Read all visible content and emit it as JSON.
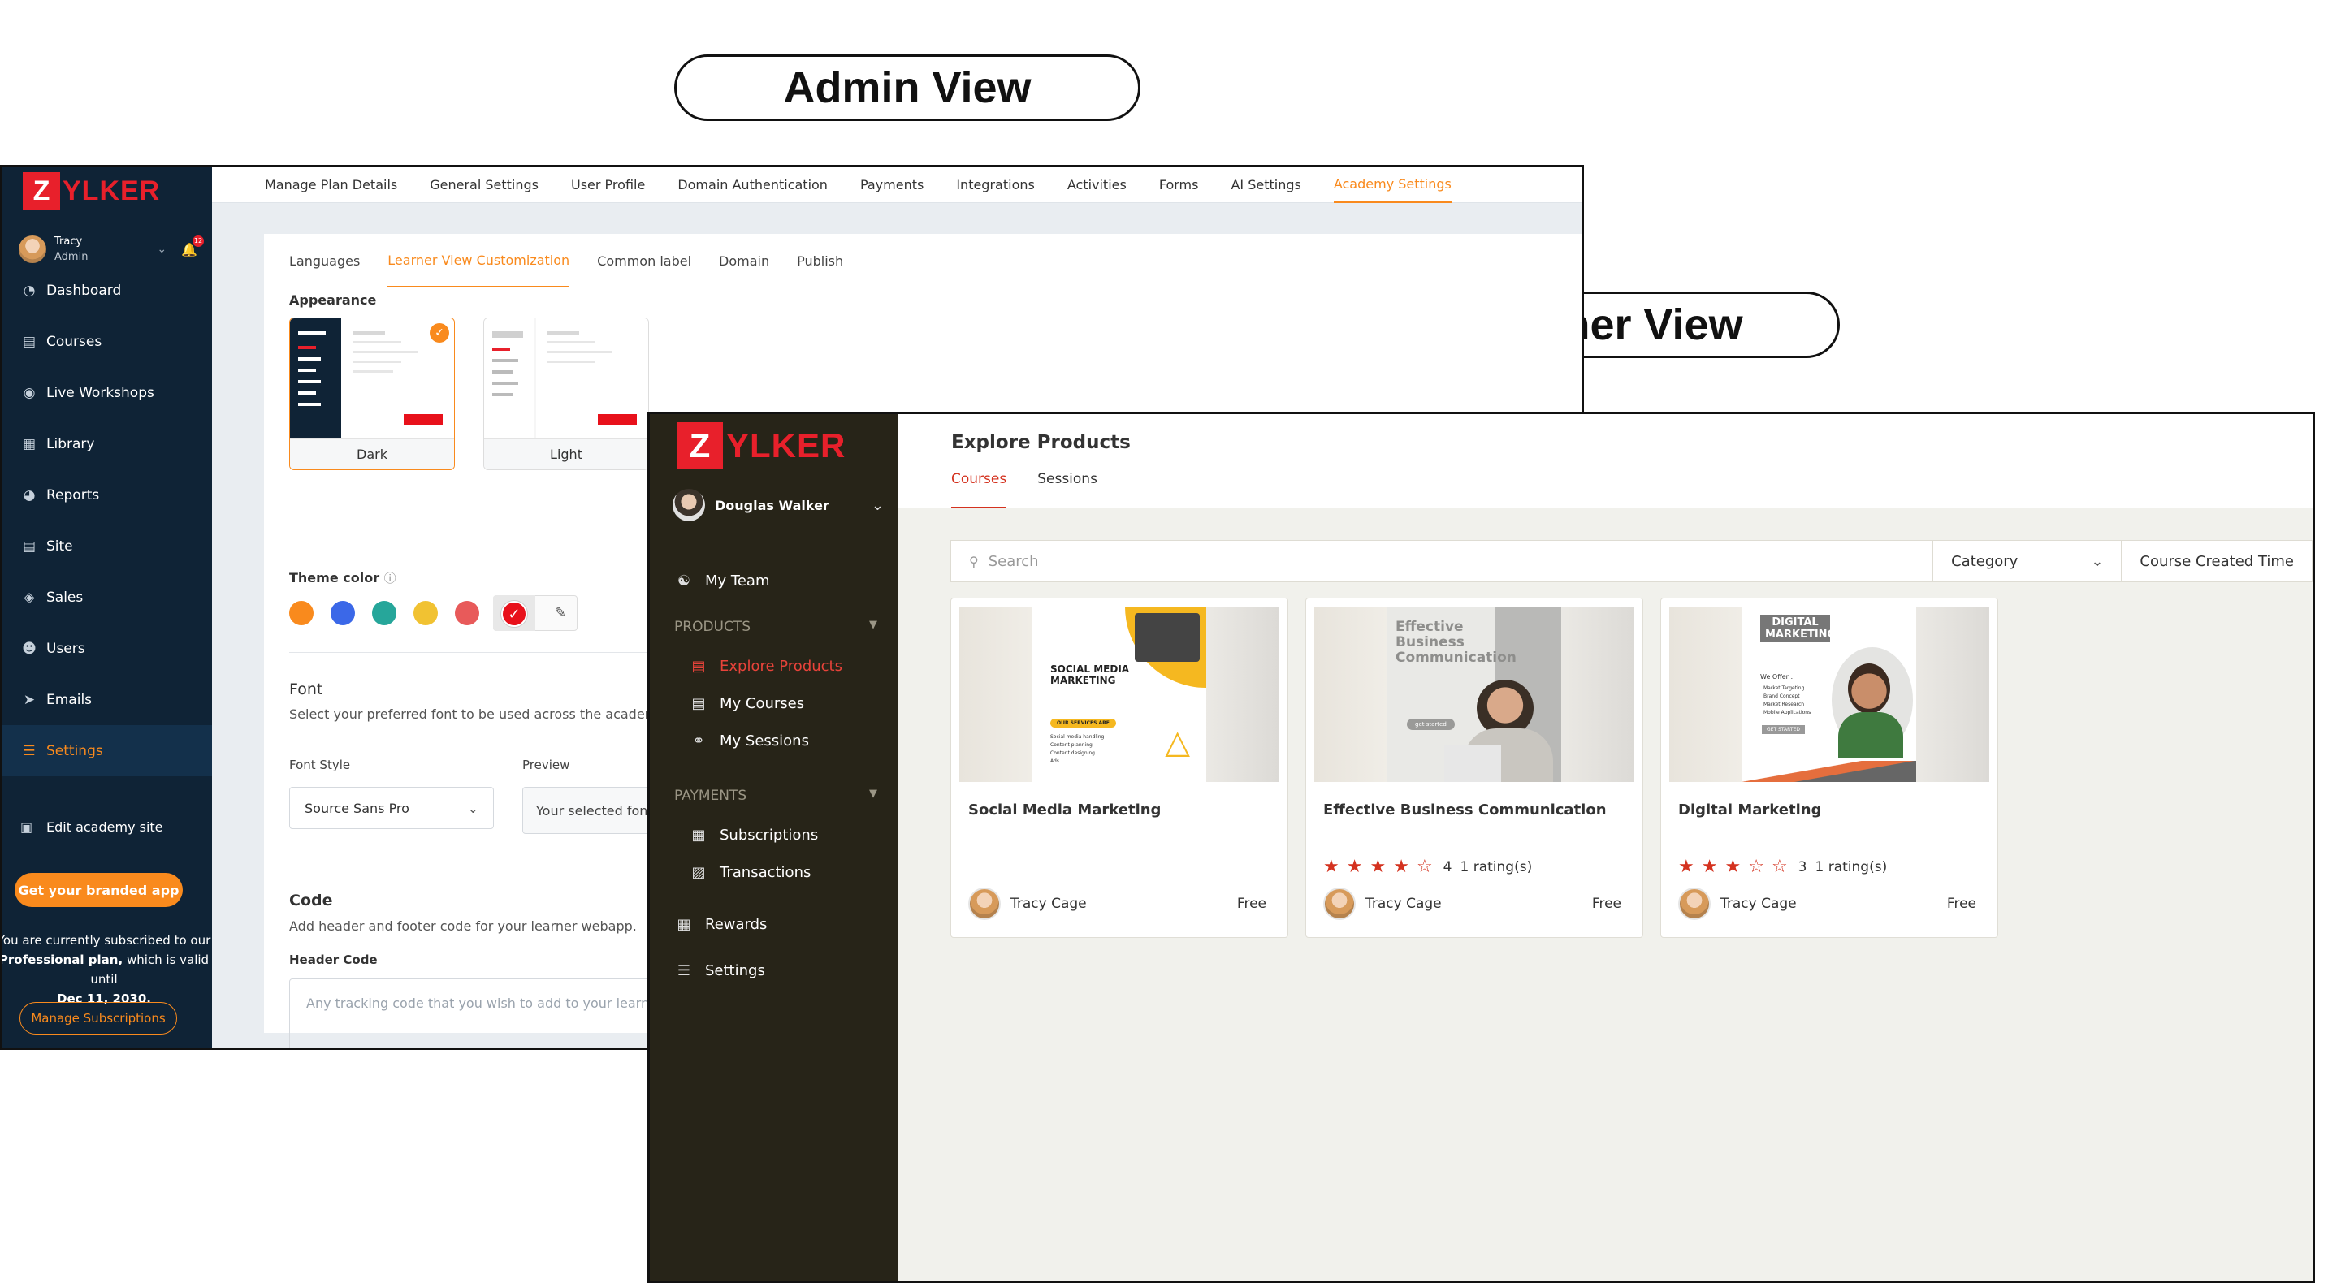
{
  "labels": {
    "admin": "Admin View",
    "learner": "Learner View"
  },
  "admin": {
    "logo": {
      "letter": "Z",
      "text": "YLKER"
    },
    "user": {
      "name": "Tracy",
      "role": "Admin",
      "notifications": "12"
    },
    "nav": [
      {
        "label": "Dashboard",
        "icon": "dashboard-icon"
      },
      {
        "label": "Courses",
        "icon": "courses-icon"
      },
      {
        "label": "Live Workshops",
        "icon": "live-workshops-icon"
      },
      {
        "label": "Library",
        "icon": "library-icon"
      },
      {
        "label": "Reports",
        "icon": "reports-icon"
      },
      {
        "label": "Site",
        "icon": "site-icon"
      },
      {
        "label": "Sales",
        "icon": "sales-tag-icon"
      },
      {
        "label": "Users",
        "icon": "users-icon"
      },
      {
        "label": "Emails",
        "icon": "emails-icon"
      },
      {
        "label": "Settings",
        "icon": "settings-sliders-icon"
      }
    ],
    "edit_site": "Edit academy site",
    "branded_app": "Get your branded app",
    "plan": {
      "line1": "You are currently subscribed to our",
      "plan_name": "Professional plan,",
      "line2": "which is valid until",
      "date": "Dec 11, 2030."
    },
    "manage_subscriptions": "Manage Subscriptions",
    "top_tabs": [
      "Manage Plan Details",
      "General Settings",
      "User Profile",
      "Domain Authentication",
      "Payments",
      "Integrations",
      "Activities",
      "Forms",
      "AI Settings",
      "Academy Settings"
    ],
    "sub_tabs": [
      "Languages",
      "Learner View Customization",
      "Common label",
      "Domain",
      "Publish"
    ],
    "appearance": {
      "heading": "Appearance",
      "options": [
        "Dark",
        "Light"
      ],
      "selected": "Dark"
    },
    "theme_color": {
      "heading": "Theme color",
      "colors": [
        "#f98a1d",
        "#3b68e8",
        "#26a69a",
        "#f1c232",
        "#e85a5a",
        "#e8111b"
      ],
      "selected": "#e8111b"
    },
    "font": {
      "heading": "Font",
      "description": "Select your preferred font to be used across the academy.",
      "style_label": "Font Style",
      "style_value": "Source Sans Pro",
      "preview_label": "Preview",
      "preview_text": "Your selected font w"
    },
    "code": {
      "heading": "Code",
      "description": "Add header and footer code for your learner webapp.",
      "header_label": "Header Code",
      "header_placeholder": "Any tracking code that you wish to add to your learner web"
    }
  },
  "learner": {
    "logo": {
      "letter": "Z",
      "text": "YLKER"
    },
    "user": {
      "name": "Douglas Walker"
    },
    "my_team": "My Team",
    "products_section": "PRODUCTS",
    "products_items": [
      "Explore Products",
      "My Courses",
      "My Sessions"
    ],
    "payments_section": "PAYMENTS",
    "payments_items": [
      "Subscriptions",
      "Transactions"
    ],
    "rewards": "Rewards",
    "settings": "Settings",
    "page_title": "Explore Products",
    "tabs": [
      "Courses",
      "Sessions"
    ],
    "search_placeholder": "Search",
    "filters": [
      "Category",
      "Course Created Time"
    ],
    "courses": [
      {
        "title": "Social Media Marketing",
        "author": "Tracy Cage",
        "price": "Free",
        "rating": null,
        "rating_count": "",
        "image_text": "SOCIAL MEDIA MARKETING",
        "image_badge": "OUR SERVICES ARE",
        "image_list": [
          "Social media handling",
          "Content planning",
          "Content designing",
          "Ads"
        ]
      },
      {
        "title": "Effective Business Communication",
        "author": "Tracy Cage",
        "price": "Free",
        "rating": 4,
        "rating_count": "1 rating(s)",
        "image_text": "Effective Business Communication",
        "image_badge": "get started"
      },
      {
        "title": "Digital Marketing",
        "author": "Tracy Cage",
        "price": "Free",
        "rating": 3,
        "rating_count": "1 rating(s)",
        "image_text": "DIGITAL MARKETING",
        "image_badge": "GET STARTED",
        "image_list": [
          "Market Targeting",
          "Brand Concept",
          "Market Research",
          "Mobile Applications"
        ],
        "image_sub": "We Offer :"
      }
    ]
  }
}
